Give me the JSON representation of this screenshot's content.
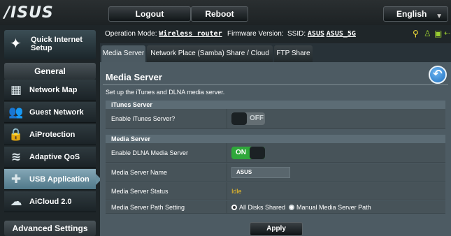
{
  "brand": {
    "logo_text": "/ISUS"
  },
  "topbar": {
    "logout_label": "Logout",
    "reboot_label": "Reboot",
    "language_label": "English"
  },
  "status": {
    "operation_mode_label": "Operation Mode:",
    "operation_mode_value": "Wireless router",
    "firmware_label": "Firmware Version:",
    "ssid_label": "SSID:",
    "ssid_1": "ASUS",
    "ssid_2": "ASUS_5G"
  },
  "sidebar": {
    "quick_setup_label": "Quick Internet Setup",
    "general_label": "General",
    "items": [
      {
        "label": "Network Map",
        "icon": "network-map-icon"
      },
      {
        "label": "Guest Network",
        "icon": "guest-network-icon"
      },
      {
        "label": "AiProtection",
        "icon": "lock-icon"
      },
      {
        "label": "Adaptive QoS",
        "icon": "qos-icon"
      },
      {
        "label": "USB Application",
        "icon": "usb-puzzle-icon"
      },
      {
        "label": "AiCloud 2.0",
        "icon": "cloud-icon"
      }
    ],
    "advanced_label": "Advanced Settings"
  },
  "tabs": [
    {
      "label": "Media Server"
    },
    {
      "label": "Network Place (Samba) Share / Cloud Disk"
    },
    {
      "label": "FTP Share"
    }
  ],
  "content": {
    "title": "Media Server",
    "description": "Set up the iTunes and DLNA media server.",
    "itunes_section": "iTunes Server",
    "enable_itunes_label": "Enable iTunes Server?",
    "itunes_toggle_text": "OFF",
    "media_section": "Media Server",
    "enable_dlna_label": "Enable DLNA Media Server",
    "dlna_toggle_text": "ON",
    "server_name_label": "Media Server Name",
    "server_name_value": "ASUS",
    "status_label": "Media Server Status",
    "status_value": "Idle",
    "path_label": "Media Server Path Setting",
    "path_option_1": "All Disks Shared",
    "path_option_2": "Manual Media Server Path",
    "apply_label": "Apply"
  }
}
